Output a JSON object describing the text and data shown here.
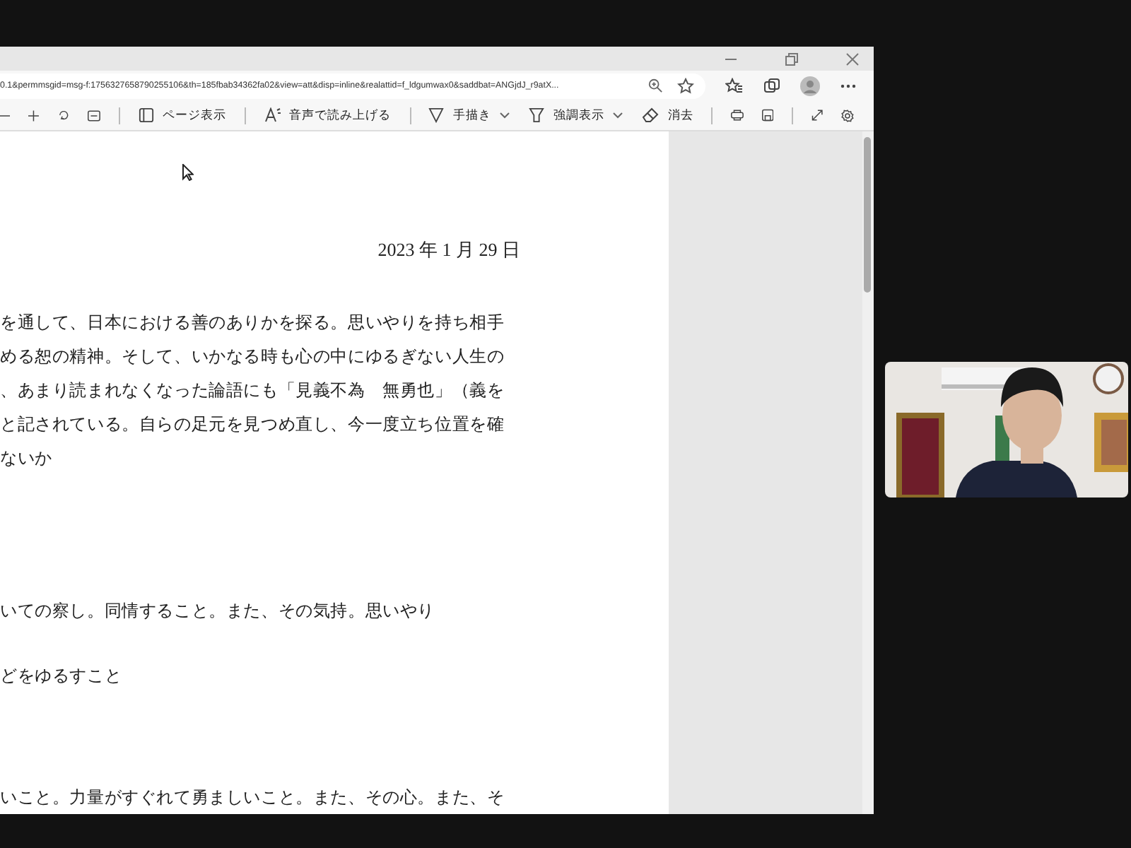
{
  "browser": {
    "url": "0.1&permmsgid=msg-f:1756327658790255106&th=185fbab34362fa02&view=att&disp=inline&realattid=f_ldgumwax0&saddbat=ANGjdJ_r9atX..."
  },
  "pdf_toolbar": {
    "page_view": "ページ表示",
    "read_aloud": "音声で読み上げる",
    "draw": "手描き",
    "highlight": "強調表示",
    "erase": "消去"
  },
  "document": {
    "date": "2023 年 1 月 29 日",
    "blocks": [
      {
        "lines": [
          "を通して、日本における善のありかを探る。思いやりを持ち相手",
          "める恕の精神。そして、いかなる時も心の中にゆるぎない人生の",
          "、あまり読まれなくなった論語にも「見義不為　無勇也」（義を",
          "と記されている。自らの足元を見つめ直し、今一度立ち位置を確",
          "ないか"
        ]
      },
      {
        "lines": [
          "いての察し。同情すること。また、その気持。思いやり"
        ]
      },
      {
        "lines": [
          "どをゆるすこと"
        ]
      },
      {
        "lines": [
          "いこと。力量がすぐれて勇ましいこと。また、その心。また、そ"
        ]
      }
    ]
  }
}
